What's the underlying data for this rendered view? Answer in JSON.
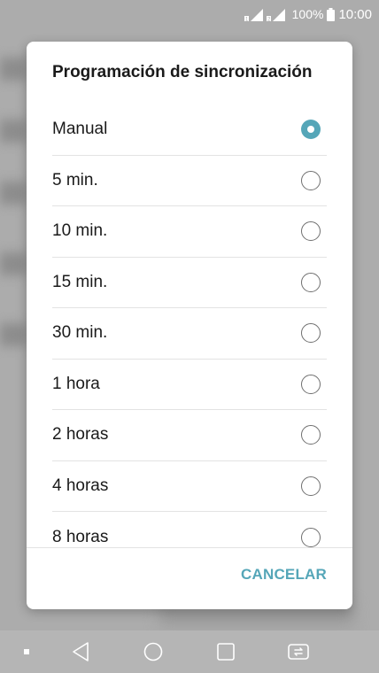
{
  "status_bar": {
    "battery_percent": "100%",
    "time": "10:00"
  },
  "dialog": {
    "title": "Programación de sincronización",
    "options": [
      {
        "label": "Manual",
        "selected": true
      },
      {
        "label": "5 min.",
        "selected": false
      },
      {
        "label": "10 min.",
        "selected": false
      },
      {
        "label": "15 min.",
        "selected": false
      },
      {
        "label": "30 min.",
        "selected": false
      },
      {
        "label": "1 hora",
        "selected": false
      },
      {
        "label": "2 horas",
        "selected": false
      },
      {
        "label": "4 horas",
        "selected": false
      },
      {
        "label": "8 horas",
        "selected": false
      }
    ],
    "cancel_label": "CANCELAR"
  },
  "colors": {
    "accent": "#55a6b8",
    "scrim": "#acacac"
  },
  "nav_bar": {
    "icons": [
      "dot-icon",
      "back-icon",
      "home-icon",
      "recent-apps-icon",
      "dual-window-icon"
    ]
  }
}
